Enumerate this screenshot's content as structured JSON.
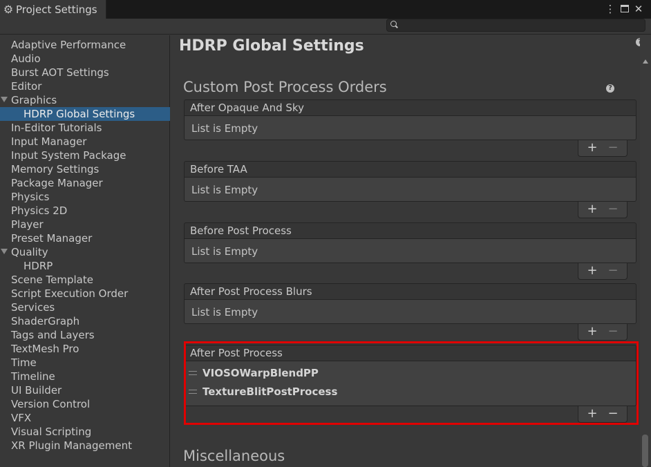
{
  "window": {
    "tab_title": "Project Settings",
    "icons": {
      "tab": "gear-icon",
      "menu": "kebab-menu-icon",
      "maximize": "maximize-icon",
      "close": "close-icon",
      "search": "search-icon",
      "help": "help-icon"
    }
  },
  "search": {
    "value": ""
  },
  "sidebar": {
    "items": [
      {
        "label": "Adaptive Performance",
        "level": 0
      },
      {
        "label": "Audio",
        "level": 0
      },
      {
        "label": "Burst AOT Settings",
        "level": 0
      },
      {
        "label": "Editor",
        "level": 0
      },
      {
        "label": "Graphics",
        "level": 0,
        "expanded": true
      },
      {
        "label": "HDRP Global Settings",
        "level": 1,
        "selected": true
      },
      {
        "label": "In-Editor Tutorials",
        "level": 0
      },
      {
        "label": "Input Manager",
        "level": 0
      },
      {
        "label": "Input System Package",
        "level": 0
      },
      {
        "label": "Memory Settings",
        "level": 0
      },
      {
        "label": "Package Manager",
        "level": 0
      },
      {
        "label": "Physics",
        "level": 0
      },
      {
        "label": "Physics 2D",
        "level": 0
      },
      {
        "label": "Player",
        "level": 0
      },
      {
        "label": "Preset Manager",
        "level": 0
      },
      {
        "label": "Quality",
        "level": 0,
        "expanded": true
      },
      {
        "label": "HDRP",
        "level": 1
      },
      {
        "label": "Scene Template",
        "level": 0
      },
      {
        "label": "Script Execution Order",
        "level": 0
      },
      {
        "label": "Services",
        "level": 0
      },
      {
        "label": "ShaderGraph",
        "level": 0
      },
      {
        "label": "Tags and Layers",
        "level": 0
      },
      {
        "label": "TextMesh Pro",
        "level": 0
      },
      {
        "label": "Time",
        "level": 0
      },
      {
        "label": "Timeline",
        "level": 0
      },
      {
        "label": "UI Builder",
        "level": 0
      },
      {
        "label": "Version Control",
        "level": 0
      },
      {
        "label": "VFX",
        "level": 0
      },
      {
        "label": "Visual Scripting",
        "level": 0
      },
      {
        "label": "XR Plugin Management",
        "level": 0
      }
    ]
  },
  "main": {
    "page_title": "HDRP Global Settings",
    "section_title": "Custom Post Process Orders",
    "lists": [
      {
        "header": "After Opaque And Sky",
        "empty_text": "List is Empty",
        "items": []
      },
      {
        "header": "Before TAA",
        "empty_text": "List is Empty",
        "items": []
      },
      {
        "header": "Before Post Process",
        "empty_text": "List is Empty",
        "items": []
      },
      {
        "header": "After Post Process Blurs",
        "empty_text": "List is Empty",
        "items": []
      },
      {
        "header": "After Post Process",
        "items": [
          "VIOSOWarpBlendPP",
          "TextureBlitPostProcess"
        ],
        "highlighted": true
      }
    ],
    "footer_buttons": {
      "add": "+",
      "remove": "−"
    },
    "next_section_title": "Miscellaneous"
  },
  "colors": {
    "selection": "#2c5d87",
    "highlight_border": "#e00000",
    "background": "#383838"
  }
}
